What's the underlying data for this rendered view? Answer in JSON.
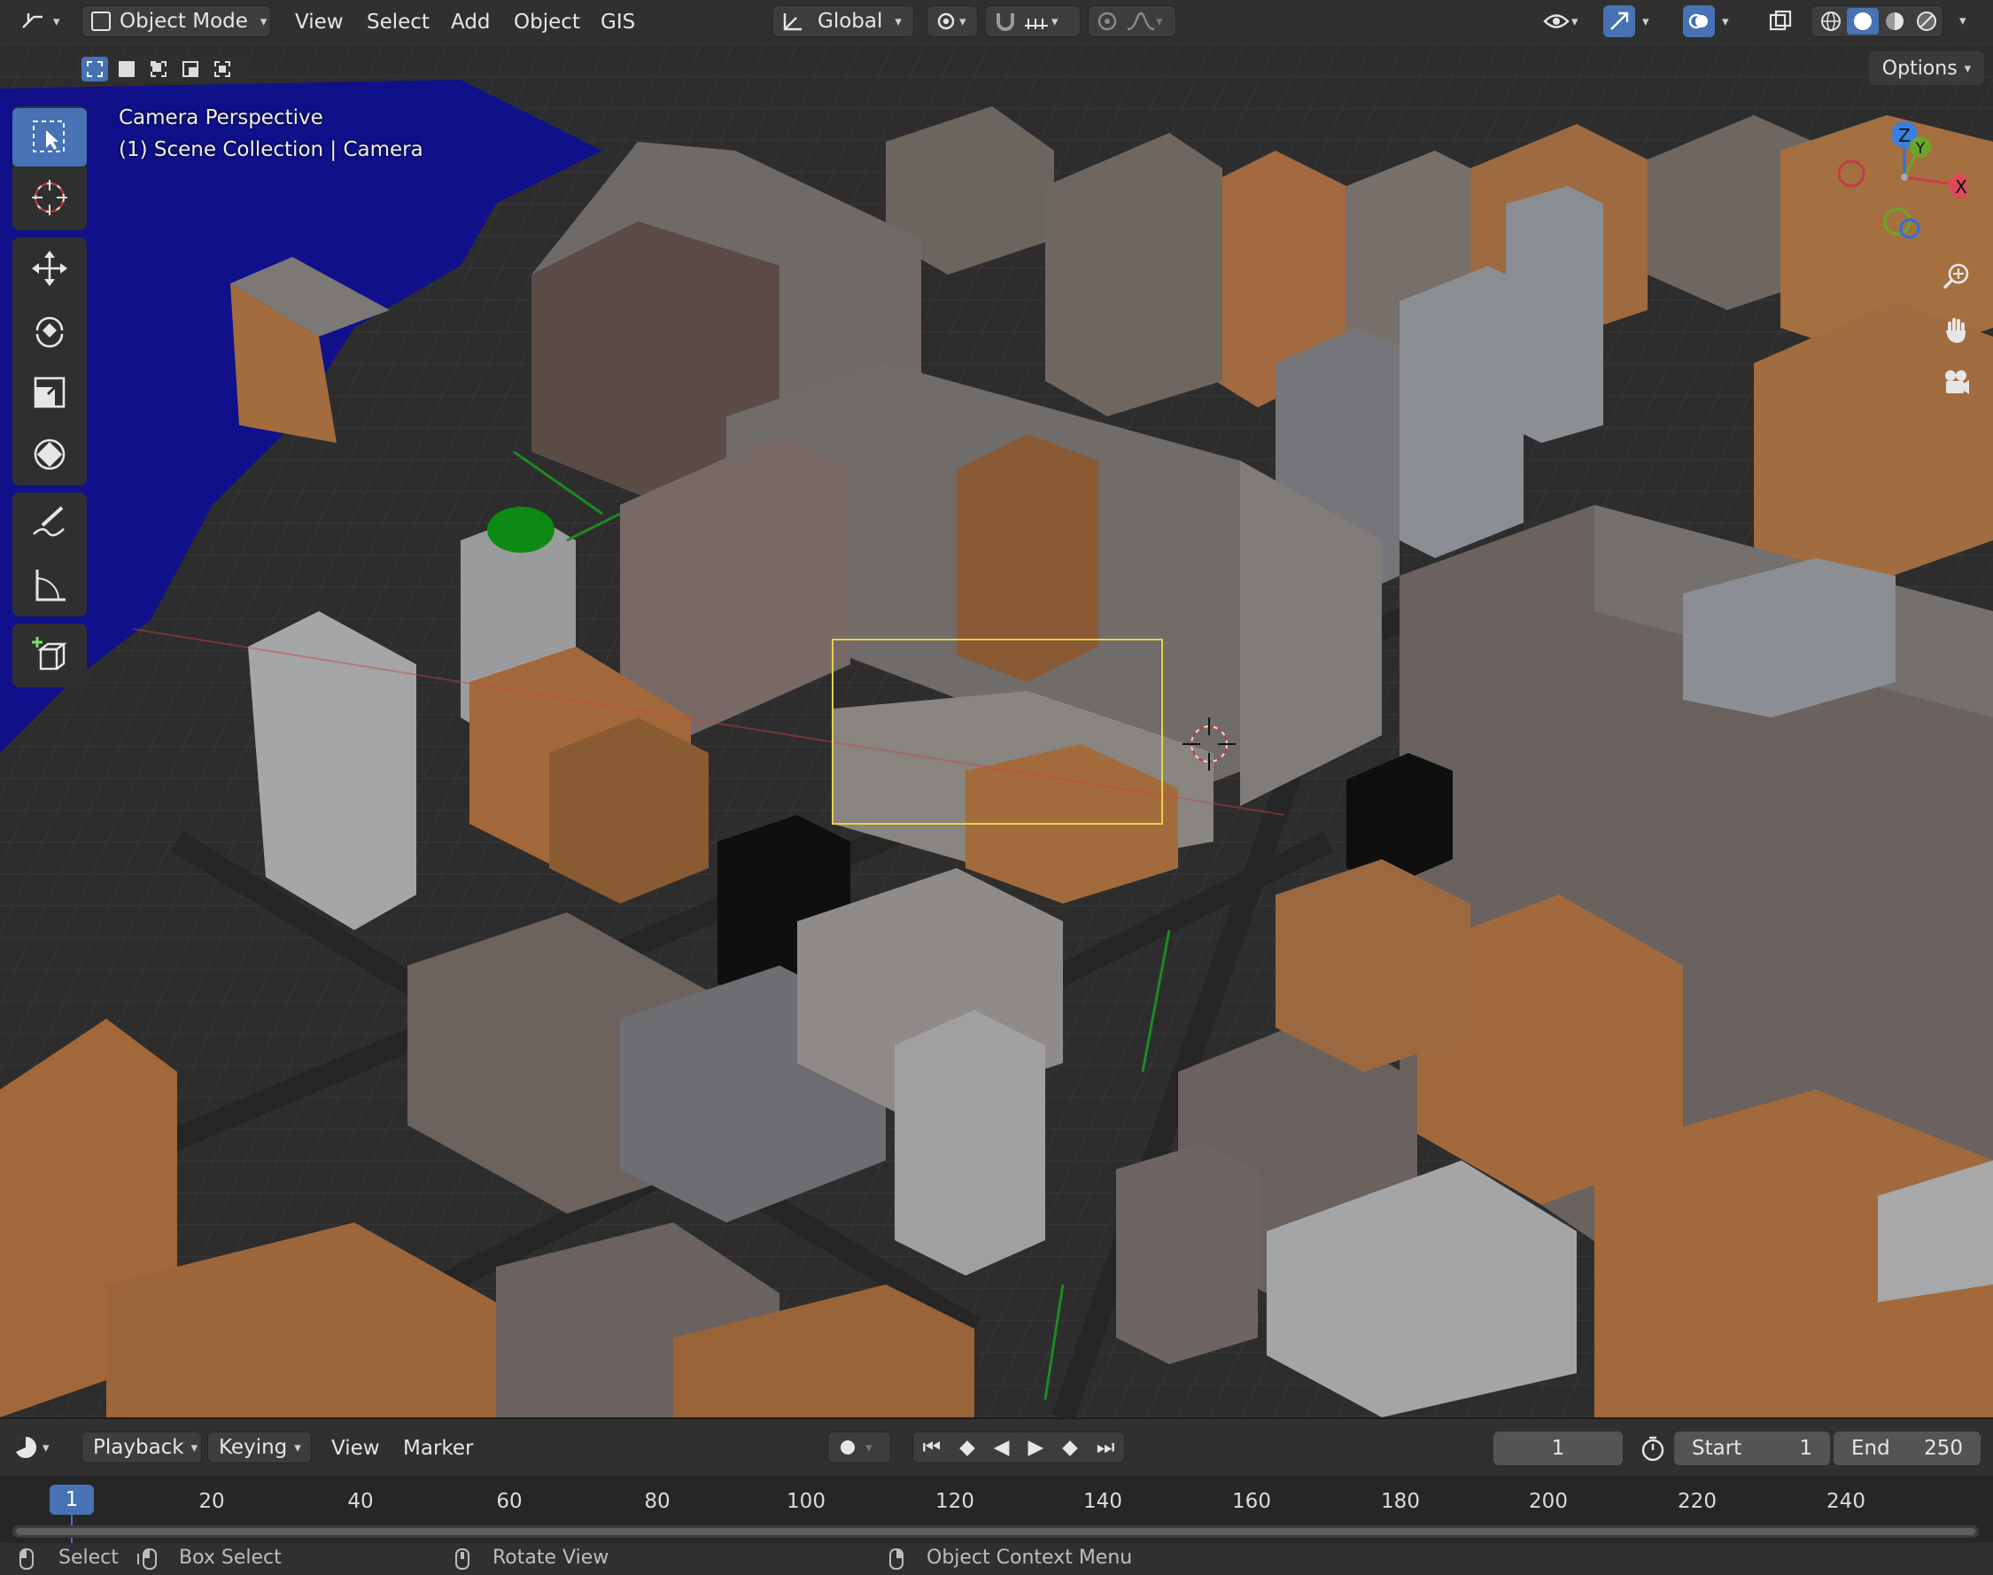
{
  "header": {
    "mode": "Object Mode",
    "menus": [
      "View",
      "Select",
      "Add",
      "Object",
      "GIS"
    ],
    "orientation": "Global",
    "options_label": "Options"
  },
  "viewport": {
    "overlay_line1": "Camera Perspective",
    "overlay_line2": "(1) Scene Collection | Camera",
    "gizmo": {
      "z": "Z",
      "y": "Y",
      "x": "X"
    }
  },
  "toolbar": {
    "tools": [
      "select-box",
      "cursor",
      "move",
      "rotate",
      "scale",
      "transform",
      "annotate",
      "measure",
      "add-cube"
    ],
    "active": "select-box"
  },
  "timeline": {
    "menus": [
      "Playback",
      "Keying",
      "View",
      "Marker"
    ],
    "current_frame": "1",
    "start_label": "Start",
    "start_value": "1",
    "end_label": "End",
    "end_value": "250",
    "frame_marker": "1",
    "ticks": [
      "20",
      "40",
      "60",
      "80",
      "100",
      "120",
      "140",
      "160",
      "180",
      "200",
      "220",
      "240"
    ]
  },
  "statusbar": {
    "select": "Select",
    "box_select": "Box Select",
    "rotate_view": "Rotate View",
    "context_menu": "Object Context Menu"
  }
}
